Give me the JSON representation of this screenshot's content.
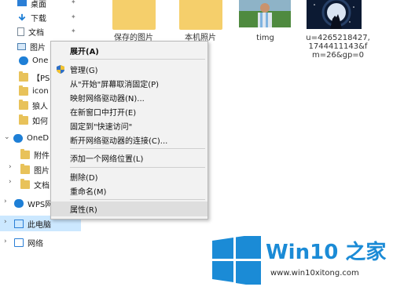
{
  "sidebar": {
    "items": [
      {
        "label": "桌面"
      },
      {
        "label": "下载"
      },
      {
        "label": "文档"
      },
      {
        "label": "图片"
      },
      {
        "label": "One"
      },
      {
        "label": "【PS"
      },
      {
        "label": "icon"
      },
      {
        "label": "狼人"
      },
      {
        "label": "如何"
      },
      {
        "label": "OneD"
      },
      {
        "label": "附件"
      },
      {
        "label": "图片"
      },
      {
        "label": "文档"
      },
      {
        "label": "WPS网"
      },
      {
        "label": "此电脑"
      },
      {
        "label": "网络"
      }
    ],
    "pin_glyph": "✦",
    "icons": {
      "desktop": "desktop-icon",
      "download": "download-arrow-icon",
      "documents": "documents-icon",
      "pictures": "pictures-icon",
      "onedrive": "onedrive-cloud-icon",
      "folder": "folder-icon",
      "wps": "wps-cloud-icon",
      "this_pc": "computer-icon",
      "network": "network-icon"
    }
  },
  "content": {
    "items": [
      {
        "label": "保存的图片"
      },
      {
        "label": "本机照片"
      },
      {
        "label": "timg"
      },
      {
        "label": "u=4265218427,\n1744411143&f\nm=26&gp=0"
      }
    ]
  },
  "context_menu": {
    "items": [
      {
        "label": "展开(A)",
        "bold": true
      },
      {
        "label": "管理(G)",
        "icon": "admin-shield-icon"
      },
      {
        "label": "从\"开始\"屏幕取消固定(P)"
      },
      {
        "label": "映射网络驱动器(N)..."
      },
      {
        "label": "在新窗口中打开(E)"
      },
      {
        "label": "固定到\"快速访问\""
      },
      {
        "label": "断开网络驱动器的连接(C)..."
      },
      {
        "label": "添加一个网络位置(L)"
      },
      {
        "label": "删除(D)"
      },
      {
        "label": "重命名(M)"
      },
      {
        "label": "属性(R)",
        "highlighted": true
      }
    ]
  },
  "watermark": {
    "title": "Win10 之家",
    "url": "www.win10xitong.com"
  },
  "colors": {
    "accent": "#1b8bd6",
    "selection": "#cce8ff",
    "menu_bg": "#f2f2f2",
    "folder": "#f5cf6b"
  }
}
